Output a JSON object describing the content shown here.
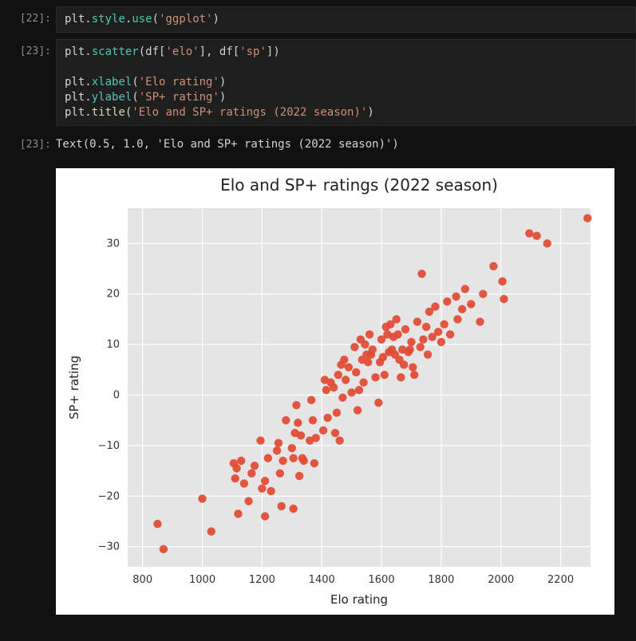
{
  "cells": {
    "c22": {
      "prompt": "[22]:",
      "tokens": {
        "t0": "plt",
        "t1": ".",
        "t2": "style",
        "t3": ".",
        "t4": "use",
        "t5": "(",
        "t6": "'ggplot'",
        "t7": ")"
      }
    },
    "c23": {
      "prompt": "[23]:",
      "tokens": {
        "l1_t0": "plt",
        "l1_t1": ".",
        "l1_t2": "scatter",
        "l1_t3": "(df[",
        "l1_t4": "'elo'",
        "l1_t5": "], df[",
        "l1_t6": "'sp'",
        "l1_t7": "])",
        "l3_t0": "plt",
        "l3_t1": ".",
        "l3_t2": "xlabel",
        "l3_t3": "(",
        "l3_t4": "'Elo rating'",
        "l3_t5": ")",
        "l4_t0": "plt",
        "l4_t1": ".",
        "l4_t2": "ylabel",
        "l4_t3": "(",
        "l4_t4": "'SP+ rating'",
        "l4_t5": ")",
        "l5_t0": "plt",
        "l5_t1": ".",
        "l5_t2": "title",
        "l5_t3": "(",
        "l5_t4": "'Elo and SP+ ratings (2022 season)'",
        "l5_t5": ")"
      }
    },
    "out23": {
      "prompt": "[23]:",
      "text": "Text(0.5, 1.0, 'Elo and SP+ ratings (2022 season)')"
    }
  },
  "chart_data": {
    "type": "scatter",
    "title": "Elo and SP+ ratings (2022 season)",
    "xlabel": "Elo rating",
    "ylabel": "SP+ rating",
    "xlim": [
      750,
      2300
    ],
    "ylim": [
      -34,
      37
    ],
    "xticks": [
      800,
      1000,
      1200,
      1400,
      1600,
      1800,
      2000,
      2200
    ],
    "yticks": [
      -30,
      -20,
      -10,
      0,
      10,
      20,
      30
    ],
    "x": [
      850,
      870,
      1000,
      1030,
      1105,
      1110,
      1115,
      1120,
      1130,
      1140,
      1155,
      1165,
      1175,
      1195,
      1200,
      1210,
      1210,
      1220,
      1230,
      1250,
      1255,
      1260,
      1265,
      1270,
      1280,
      1300,
      1305,
      1305,
      1310,
      1315,
      1320,
      1325,
      1330,
      1335,
      1340,
      1360,
      1365,
      1370,
      1375,
      1380,
      1405,
      1410,
      1415,
      1420,
      1430,
      1440,
      1445,
      1450,
      1455,
      1460,
      1465,
      1470,
      1475,
      1480,
      1490,
      1500,
      1510,
      1515,
      1520,
      1525,
      1530,
      1535,
      1540,
      1545,
      1550,
      1555,
      1560,
      1565,
      1570,
      1580,
      1590,
      1595,
      1600,
      1605,
      1610,
      1615,
      1620,
      1625,
      1630,
      1635,
      1640,
      1645,
      1650,
      1655,
      1660,
      1665,
      1670,
      1675,
      1680,
      1690,
      1695,
      1700,
      1705,
      1710,
      1720,
      1730,
      1735,
      1740,
      1750,
      1755,
      1760,
      1770,
      1780,
      1790,
      1800,
      1810,
      1820,
      1830,
      1850,
      1855,
      1870,
      1880,
      1900,
      1930,
      1940,
      1975,
      2005,
      2010,
      2095,
      2120,
      2155,
      2290
    ],
    "y": [
      -25.5,
      -30.5,
      -20.5,
      -27.0,
      -13.5,
      -16.5,
      -14.5,
      -23.5,
      -13.0,
      -17.5,
      -21.0,
      -15.5,
      -14.0,
      -9.0,
      -18.5,
      -17.0,
      -24.0,
      -12.5,
      -19.0,
      -11.0,
      -9.5,
      -15.5,
      -22.0,
      -13.0,
      -5.0,
      -10.5,
      -22.5,
      -12.5,
      -7.5,
      -2.0,
      -5.5,
      -16.0,
      -8.0,
      -12.5,
      -13.0,
      -9.0,
      -1.0,
      -5.0,
      -13.5,
      -8.5,
      -7.0,
      3.0,
      1.0,
      -4.5,
      2.5,
      1.5,
      -7.5,
      -3.5,
      4.0,
      -9.0,
      6.0,
      -0.5,
      7.0,
      3.0,
      5.5,
      0.5,
      9.5,
      4.5,
      -3.0,
      1.0,
      11.0,
      7.0,
      2.5,
      10.0,
      8.0,
      6.5,
      12.0,
      8.0,
      9.0,
      3.5,
      -1.5,
      6.5,
      11.0,
      7.5,
      4.0,
      13.5,
      12.0,
      8.5,
      14.0,
      9.0,
      11.5,
      8.0,
      15.0,
      12.0,
      7.0,
      3.5,
      9.0,
      6.0,
      13.0,
      8.5,
      9.0,
      10.5,
      5.5,
      4.0,
      14.5,
      9.5,
      24.0,
      11.0,
      13.5,
      8.0,
      16.5,
      11.5,
      17.5,
      12.5,
      10.5,
      14.0,
      18.5,
      12.0,
      19.5,
      15.0,
      17.0,
      21.0,
      18.0,
      14.5,
      20.0,
      25.5,
      22.5,
      19.0,
      32.0,
      31.5,
      30.0,
      35.0
    ],
    "marker_color": "#e24a33"
  }
}
